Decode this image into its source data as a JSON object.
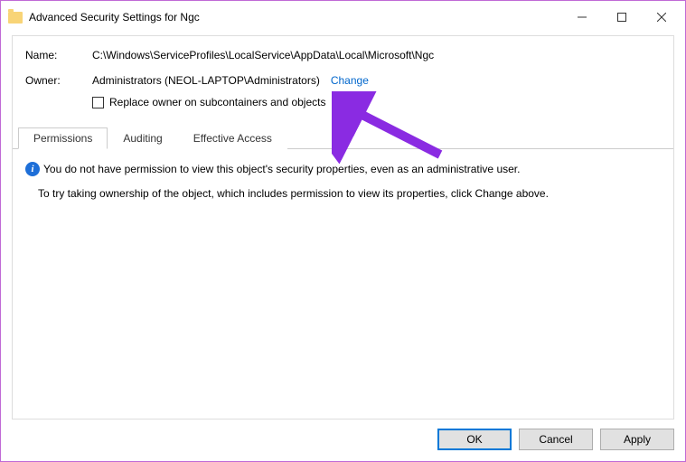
{
  "window": {
    "title": "Advanced Security Settings for Ngc"
  },
  "info": {
    "name_label": "Name:",
    "name_value": "C:\\Windows\\ServiceProfiles\\LocalService\\AppData\\Local\\Microsoft\\Ngc",
    "owner_label": "Owner:",
    "owner_value": "Administrators (NEOL-LAPTOP\\Administrators)",
    "change_link": "Change",
    "replace_checkbox": "Replace owner on subcontainers and objects"
  },
  "tabs": {
    "permissions": "Permissions",
    "auditing": "Auditing",
    "effective": "Effective Access"
  },
  "messages": {
    "no_permission": "You do not have permission to view this object's security properties, even as an administrative user.",
    "hint": "To try taking ownership of the object, which includes permission to view its properties, click Change above."
  },
  "buttons": {
    "ok": "OK",
    "cancel": "Cancel",
    "apply": "Apply"
  }
}
